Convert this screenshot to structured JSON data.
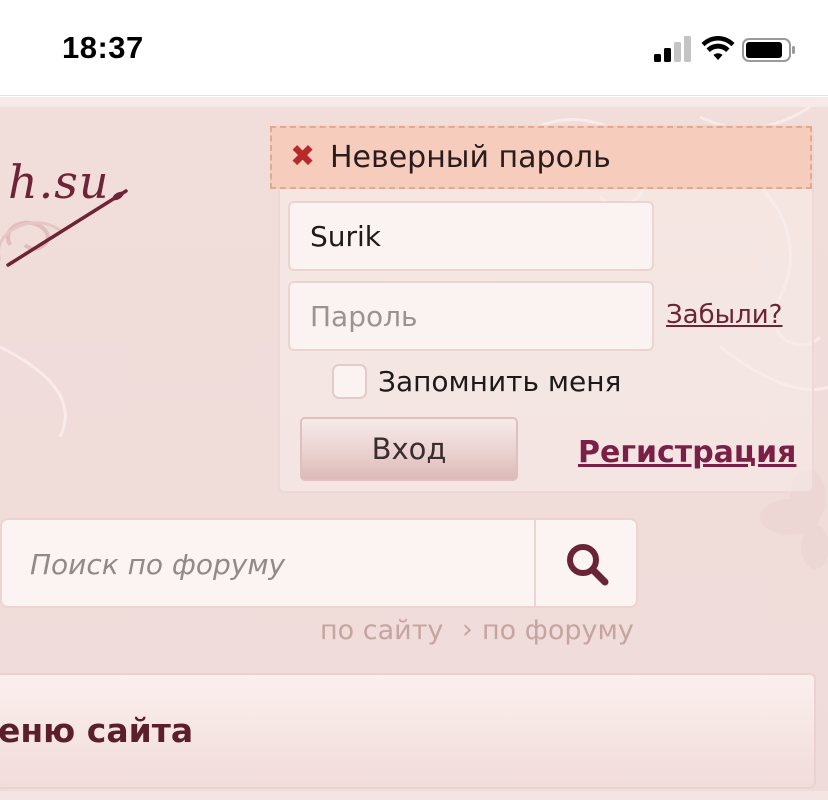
{
  "status_bar": {
    "time": "18:37",
    "icons": [
      "signal-icon",
      "wifi-icon",
      "battery-icon"
    ]
  },
  "logo": {
    "text": "h.su"
  },
  "login": {
    "error_message": "Неверный пароль",
    "error_icon": "close-icon",
    "username_value": "Surik",
    "password_placeholder": "Пароль",
    "forgot_label": "Забыли?",
    "remember_label": "Запомнить меня",
    "submit_label": "Вход",
    "register_label": "Регистрация"
  },
  "search": {
    "placeholder": "Поиск по форуму",
    "icon": "search-icon",
    "scope_site": "по сайту",
    "scope_arrow": "›",
    "scope_forum": "по форуму"
  },
  "menu": {
    "title": "еню сайта"
  },
  "colors": {
    "accent": "#7a1f45",
    "error_bg": "#f6cdbd",
    "page_bg": "#f1dedb"
  }
}
